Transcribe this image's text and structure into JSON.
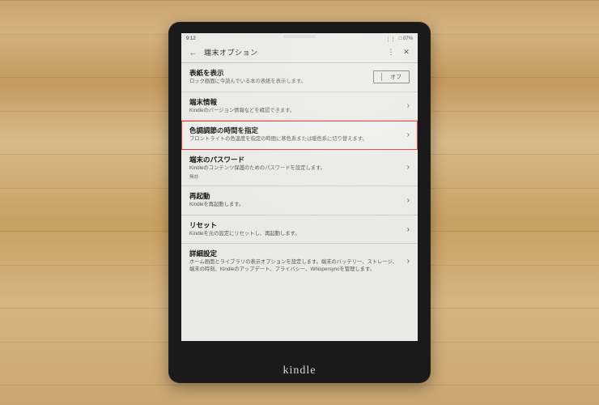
{
  "status": {
    "time": "9:12",
    "battery": "□ 07%"
  },
  "header": {
    "title": "端末オプション"
  },
  "rows": [
    {
      "title": "表紙を表示",
      "desc": "ロック画面に今読んでいる本の表紙を表示します。",
      "toggle": "オフ",
      "highlighted": false
    },
    {
      "title": "端末情報",
      "desc": "Kindleのバージョン情報などを確認できます。",
      "highlighted": false
    },
    {
      "title": "色調調節の時間を指定",
      "desc": "フロントライトの色温度を指定の時間に寒色系または暖色系に切り替えます。",
      "highlighted": true
    },
    {
      "title": "端末のパスワード",
      "desc": "Kindleのコンテンツ保護のためのパスワードを設定します。",
      "sub": "無効",
      "highlighted": false
    },
    {
      "title": "再起動",
      "desc": "Kindleを再起動します。",
      "highlighted": false
    },
    {
      "title": "リセット",
      "desc": "Kindleを元の設定にリセットし、再起動します。",
      "highlighted": false
    },
    {
      "title": "詳細設定",
      "desc": "ホーム画面とライブラリの表示オプションを設定します。端末のバッテリー、ストレージ、端末の時刻、Kindleのアップデート、プライバシー、Whispersyncを管理します。",
      "highlighted": false
    }
  ],
  "brand": "kindle"
}
